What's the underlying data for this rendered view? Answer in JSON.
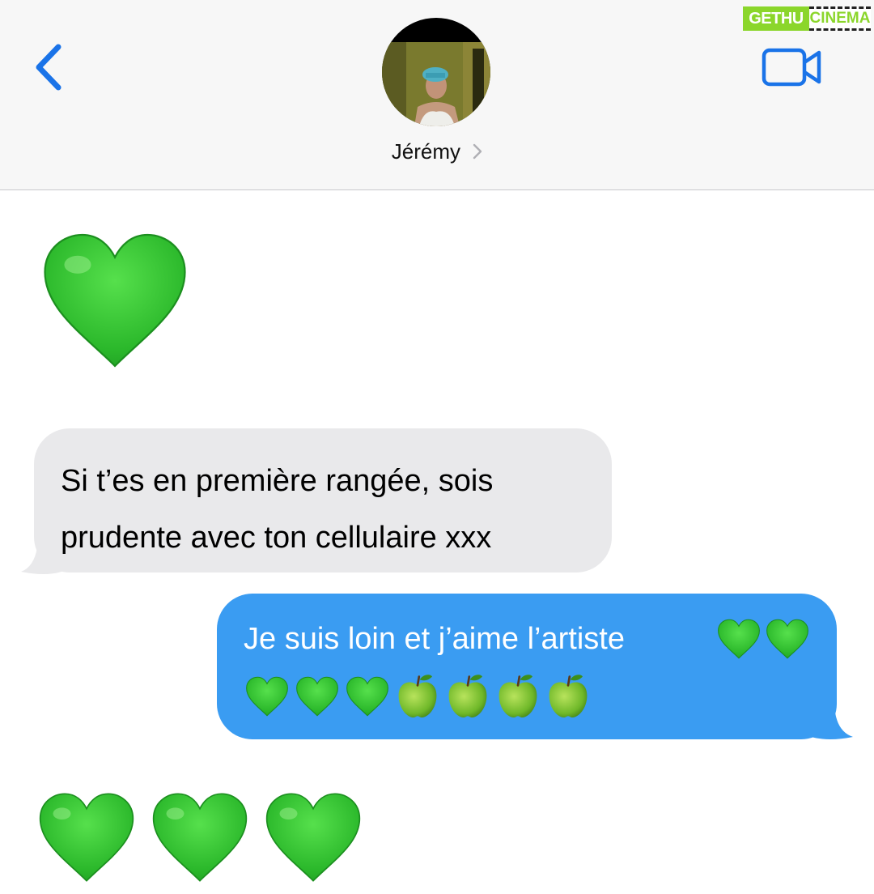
{
  "header": {
    "contact_name": "Jérémy",
    "back_icon": "chevron-left-icon",
    "video_icon": "video-camera-icon",
    "accent_color": "#1a73e8"
  },
  "watermark": {
    "left": "GETHU",
    "right": "CINEMA"
  },
  "messages": [
    {
      "direction": "incoming",
      "type": "emoji",
      "content": "💚"
    },
    {
      "direction": "incoming",
      "type": "text",
      "content": [
        "Si t’es en première rangée, sois",
        "prudente avec ton cellulaire xxx"
      ]
    },
    {
      "direction": "outgoing",
      "type": "text",
      "content": "Je suis loin et j’aime l’artiste",
      "emojis": "💚💚💚💚💚🍏🍏🍏🍏"
    },
    {
      "direction": "incoming",
      "type": "emoji",
      "content": "💚💚💚"
    }
  ],
  "colors": {
    "incoming_bubble": "#e9e9eb",
    "outgoing_bubble": "#3a9cf2",
    "heart_green": "#2bc02b"
  }
}
